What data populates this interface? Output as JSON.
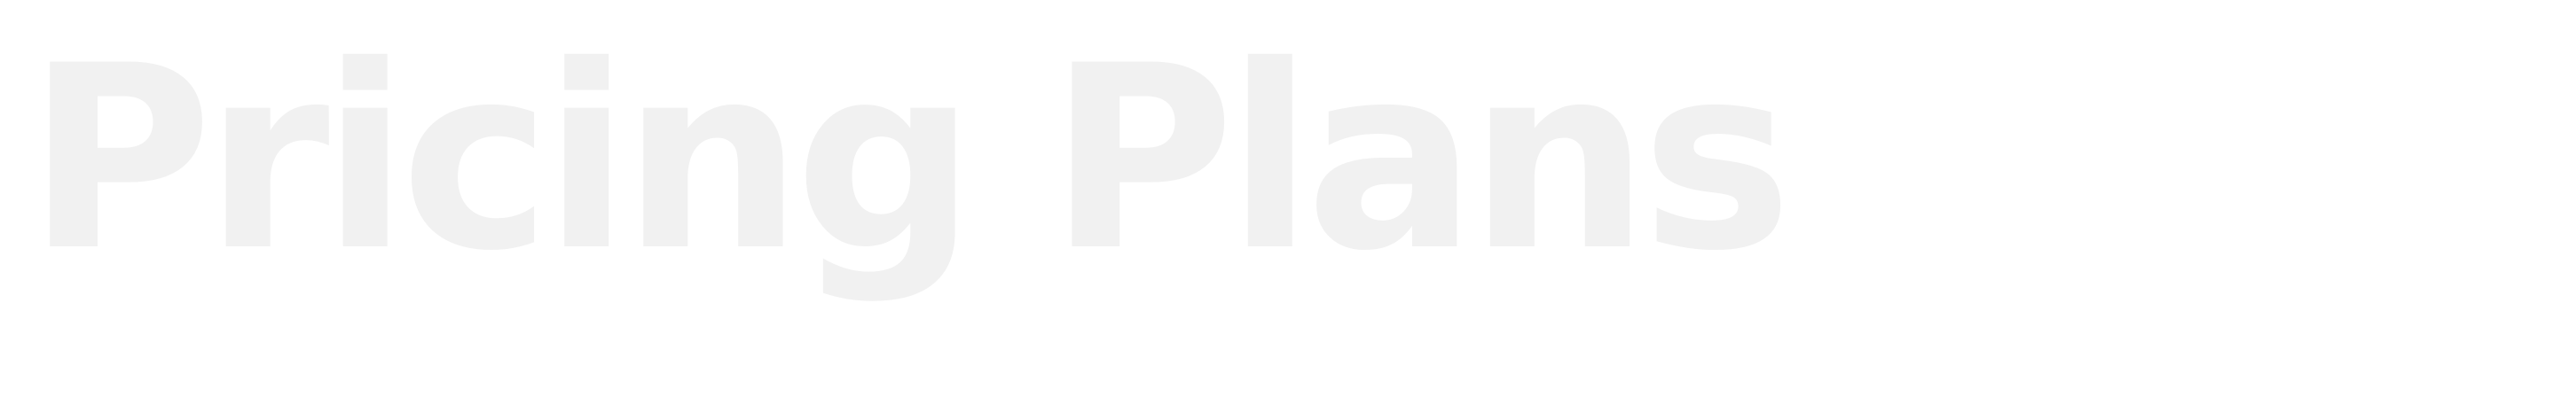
{
  "headline": {
    "text": "Pricing Plans",
    "color": "#f1f1f1"
  }
}
